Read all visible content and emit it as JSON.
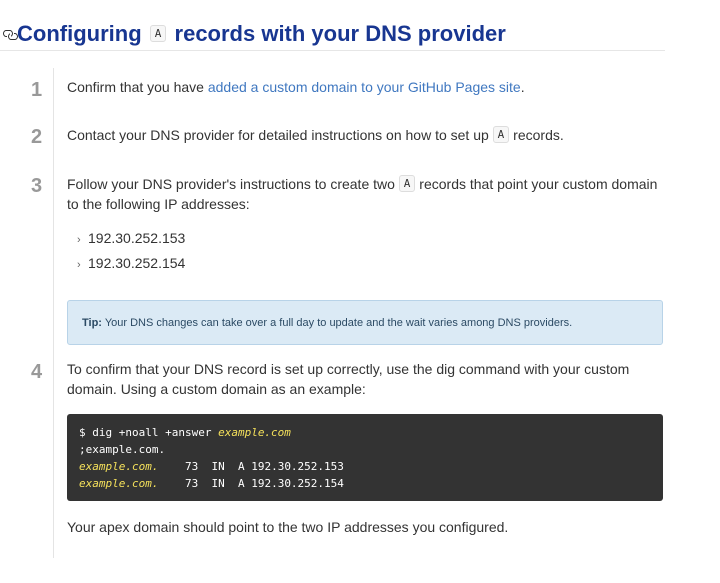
{
  "heading": {
    "prefix": "Configuring",
    "code": "A",
    "suffix": "records with your DNS provider"
  },
  "steps": [
    {
      "num": "1",
      "before": "Confirm that you have ",
      "link": "added a custom domain to your GitHub Pages site",
      "after": "."
    },
    {
      "num": "2",
      "before": "Contact your DNS provider for detailed instructions on how to set up ",
      "code": "A",
      "after": " records."
    },
    {
      "num": "3",
      "before": "Follow your DNS provider's instructions to create two ",
      "code": "A",
      "after": " records that point your custom domain to the following IP addresses:"
    },
    {
      "num": "4",
      "text": "To confirm that your DNS record is set up correctly, use the dig command with your custom domain. Using a custom domain as an example:"
    }
  ],
  "ips": [
    "192.30.252.153",
    "192.30.252.154"
  ],
  "tip": {
    "label": "Tip:",
    "text": " Your DNS changes can take over a full day to update and the wait varies among DNS providers."
  },
  "code": {
    "line1_cmd": "$ dig +noall +answer ",
    "line1_domain": "example.com",
    "line2": ";example.com.",
    "line3_domain": "example.com.",
    "line3_rest": "    73  IN  A 192.30.252.153",
    "line4_domain": "example.com.",
    "line4_rest": "    73  IN  A 192.30.252.154"
  },
  "footer": "Your apex domain should point to the two IP addresses you configured.",
  "colors": {
    "heading": "#183691",
    "link": "#4078c0",
    "code_bg": "#333333",
    "code_highlight": "#f5e15b",
    "tip_bg": "#dbeaf5"
  }
}
